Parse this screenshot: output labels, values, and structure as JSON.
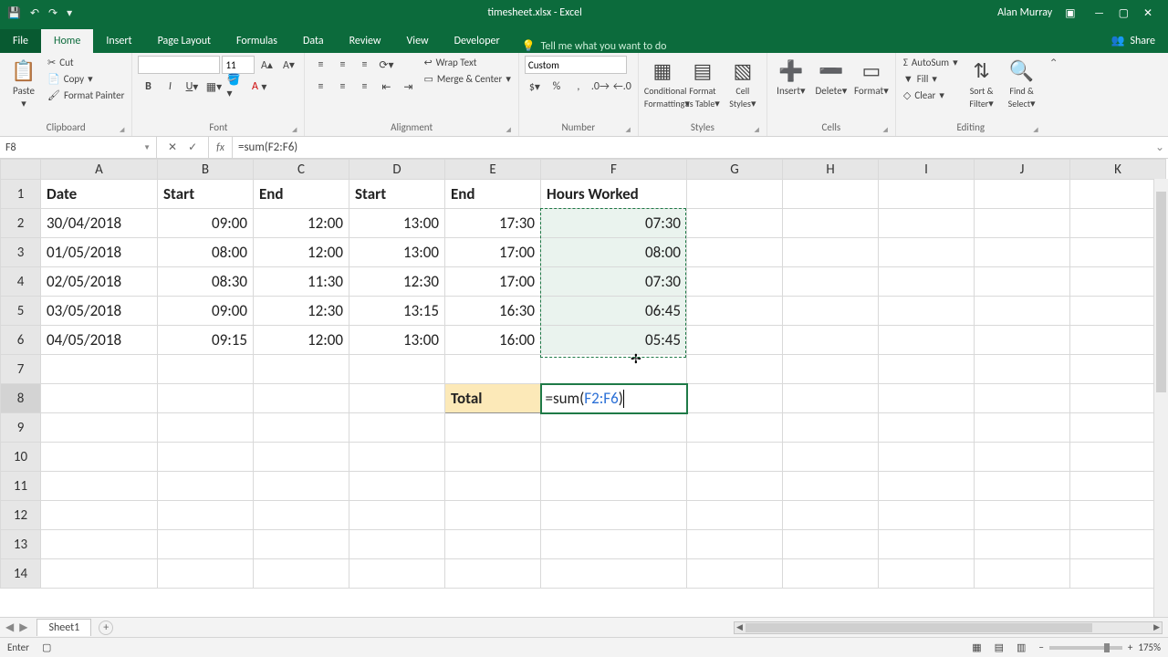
{
  "titlebar": {
    "filename": "timesheet.xlsx - Excel",
    "user": "Alan Murray"
  },
  "tabs": {
    "file": "File",
    "home": "Home",
    "insert": "Insert",
    "pageLayout": "Page Layout",
    "formulas": "Formulas",
    "data": "Data",
    "review": "Review",
    "view": "View",
    "developer": "Developer",
    "tellme": "Tell me what you want to do",
    "share": "Share"
  },
  "ribbon": {
    "clipboard": {
      "paste": "Paste",
      "cut": "Cut",
      "copy": "Copy",
      "painter": "Format Painter",
      "label": "Clipboard"
    },
    "font": {
      "size": "11",
      "label": "Font"
    },
    "alignment": {
      "wrap": "Wrap Text",
      "merge": "Merge & Center",
      "label": "Alignment"
    },
    "number": {
      "format": "Custom",
      "label": "Number"
    },
    "styles": {
      "cond": "Conditional Formatting",
      "table": "Format as Table",
      "cell": "Cell Styles",
      "label": "Styles"
    },
    "cells": {
      "insert": "Insert",
      "delete": "Delete",
      "format": "Format",
      "label": "Cells"
    },
    "editing": {
      "sum": "AutoSum",
      "fill": "Fill",
      "clear": "Clear",
      "sort": "Sort & Filter",
      "find": "Find & Select",
      "label": "Editing"
    }
  },
  "namebox": "F8",
  "formula": "=sum(F2:F6)",
  "formula_parts": {
    "pre": "=sum(",
    "ref": "F2:F6",
    "post": ")"
  },
  "columns": [
    "A",
    "B",
    "C",
    "D",
    "E",
    "F",
    "G",
    "H",
    "I",
    "J",
    "K"
  ],
  "headers": [
    "Date",
    "Start",
    "End",
    "Start",
    "End",
    "Hours Worked"
  ],
  "rows": [
    {
      "n": 2,
      "d": "30/04/2018",
      "s1": "09:00",
      "e1": "12:00",
      "s2": "13:00",
      "e2": "17:30",
      "h": "07:30"
    },
    {
      "n": 3,
      "d": "01/05/2018",
      "s1": "08:00",
      "e1": "12:00",
      "s2": "13:00",
      "e2": "17:00",
      "h": "08:00"
    },
    {
      "n": 4,
      "d": "02/05/2018",
      "s1": "08:30",
      "e1": "11:30",
      "s2": "12:30",
      "e2": "17:00",
      "h": "07:30"
    },
    {
      "n": 5,
      "d": "03/05/2018",
      "s1": "09:00",
      "e1": "12:30",
      "s2": "13:15",
      "e2": "16:30",
      "h": "06:45"
    },
    {
      "n": 6,
      "d": "04/05/2018",
      "s1": "09:15",
      "e1": "12:00",
      "s2": "13:00",
      "e2": "16:00",
      "h": "05:45"
    }
  ],
  "totalLabel": "Total",
  "sheet": "Sheet1",
  "status": {
    "mode": "Enter",
    "zoom": "175%"
  }
}
